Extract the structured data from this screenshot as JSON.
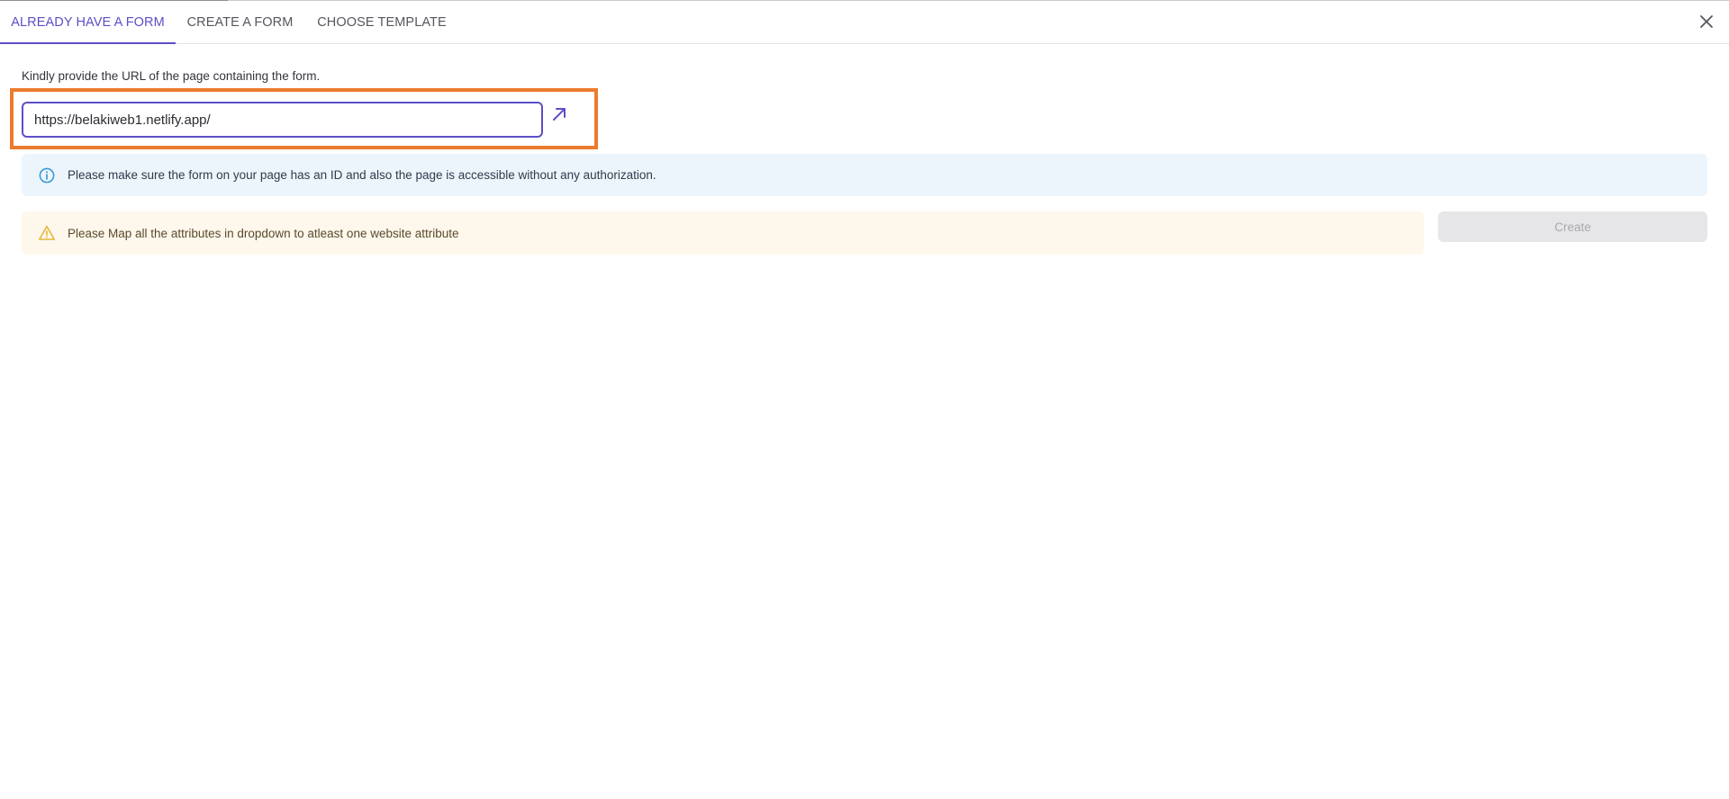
{
  "tabs": [
    {
      "label": "ALREADY HAVE A FORM",
      "active": true
    },
    {
      "label": "CREATE A FORM",
      "active": false
    },
    {
      "label": "CHOOSE TEMPLATE",
      "active": false
    }
  ],
  "form": {
    "url_label": "Kindly provide the URL of the page containing the form.",
    "url_value": "https://belakiweb1.netlify.app/",
    "open_link_icon": "arrow-up-right-icon"
  },
  "info_banner": {
    "icon": "info-icon",
    "text": "Please make sure the form on your page has an ID and also the page is accessible without any authorization."
  },
  "warning_banner": {
    "icon": "warning-icon",
    "text": "Please Map all the attributes in dropdown to atleast one website attribute"
  },
  "actions": {
    "create_label": "Create",
    "create_disabled": true
  },
  "colors": {
    "accent": "#5b4fc7",
    "highlight": "#ec7b2d",
    "info_bg": "#edf5fc",
    "info_icon": "#3a9ad9",
    "warning_bg": "#fef7ec",
    "warning_icon": "#e9b63a",
    "disabled_bg": "#e6e6e8"
  }
}
